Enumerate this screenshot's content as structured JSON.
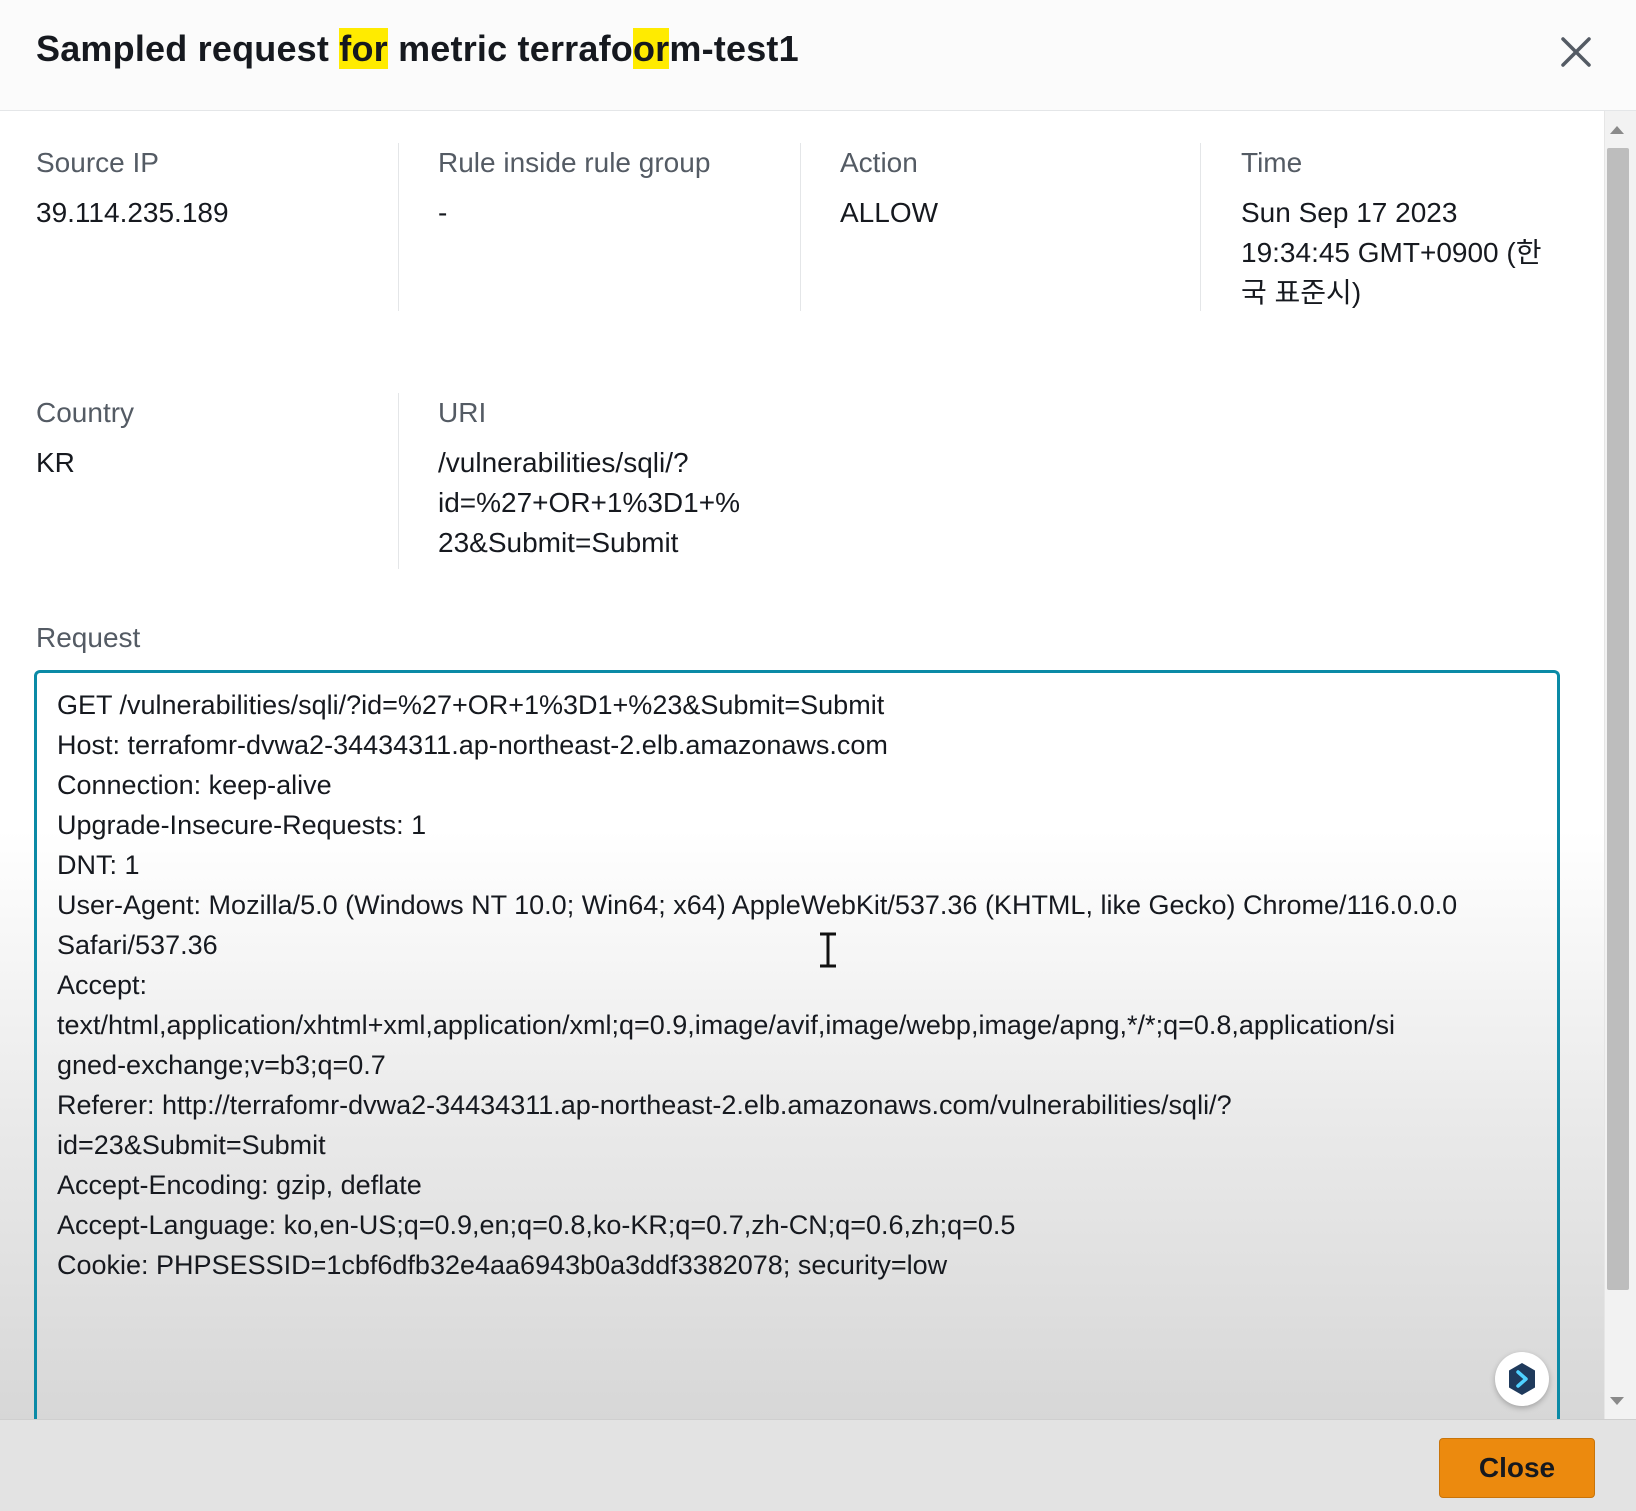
{
  "modal": {
    "title_parts": {
      "p1": "Sampled request ",
      "p2": "for",
      "p3": " metric terrafo",
      "p4": "or",
      "p5": "m-test1"
    },
    "close_icon": "close-x-icon"
  },
  "details": {
    "source_ip": {
      "label": "Source IP",
      "value": "39.114.235.189"
    },
    "rule": {
      "label": "Rule inside rule group",
      "value": "-"
    },
    "action": {
      "label": "Action",
      "value": "ALLOW"
    },
    "time": {
      "label": "Time",
      "line1": "Sun Sep 17 2023",
      "line2": "19:34:45 GMT+0900 (한",
      "line3": "국 표준시)"
    },
    "country": {
      "label": "Country",
      "value": "KR"
    },
    "uri": {
      "label": "URI",
      "line1": "/vulnerabilities/sqli/?",
      "line2": "id=%27+OR+1%3D1+%",
      "line3": "23&Submit=Submit"
    }
  },
  "request": {
    "label": "Request",
    "lines": [
      "GET /vulnerabilities/sqli/?id=%27+OR+1%3D1+%23&Submit=Submit",
      "Host: terrafomr-dvwa2-34434311.ap-northeast-2.elb.amazonaws.com",
      "Connection: keep-alive",
      "Upgrade-Insecure-Requests: 1",
      "DNT: 1",
      "User-Agent: Mozilla/5.0 (Windows NT 10.0; Win64; x64) AppleWebKit/537.36 (KHTML, like Gecko) Chrome/116.0.0.0",
      "Safari/537.36",
      "Accept:",
      "text/html,application/xhtml+xml,application/xml;q=0.9,image/avif,image/webp,image/apng,*/*;q=0.8,application/si",
      "gned-exchange;v=b3;q=0.7",
      "Referer: http://terrafomr-dvwa2-34434311.ap-northeast-2.elb.amazonaws.com/vulnerabilities/sqli/?",
      "id=23&Submit=Submit",
      "Accept-Encoding: gzip, deflate",
      "Accept-Language: ko,en-US;q=0.9,en;q=0.8,ko-KR;q=0.7,zh-CN;q=0.6,zh;q=0.5",
      "Cookie: PHPSESSID=1cbf6dfb32e4aa6943b0a3ddf3382078; security=low"
    ]
  },
  "footer": {
    "close_label": "Close"
  },
  "colors": {
    "accent_border": "#0b8aa6",
    "primary_button": "#ec8a0e",
    "highlight": "#ffeb00"
  }
}
